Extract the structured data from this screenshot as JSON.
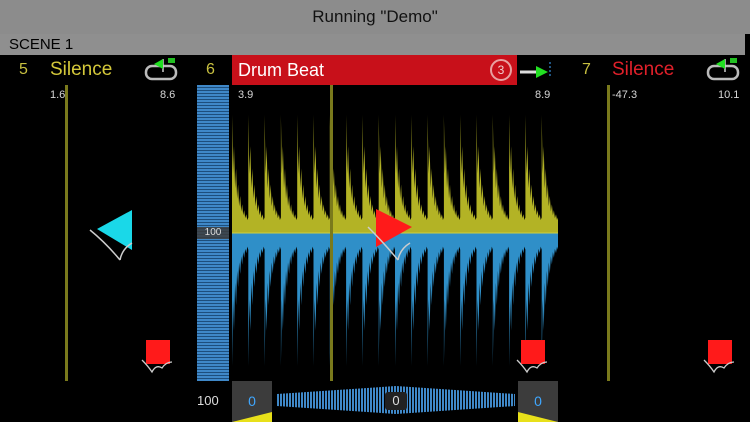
{
  "title": "Running \"Demo\"",
  "scene": "SCENE 1",
  "cells": [
    {
      "number": "5",
      "name": "Silence",
      "left_value": "1.6",
      "right_value": "8.6",
      "name_color": "#d4c83a",
      "number_color": "#c8c040"
    },
    {
      "number": "6",
      "name": "Drum Beat",
      "left_value": "3.9",
      "right_value": "8.9",
      "loop_count": "3",
      "number_color": "#c8c040",
      "header_color": "#c8101a"
    },
    {
      "number": "7",
      "name": "Silence",
      "left_value": "-47.3",
      "right_value": "10.1",
      "name_color": "#e0202a",
      "number_color": "#c8c040"
    }
  ],
  "volume": {
    "meter_label": "100",
    "bottom_value": "100"
  },
  "pan": {
    "left_value": "0",
    "center_value": "0",
    "right_value": "0"
  },
  "colors": {
    "waveform_top": "#b3b325",
    "waveform_bottom": "#2f8fc8",
    "play_triangle": "#ff1a1a",
    "cyan_triangle": "#1ad8e8",
    "stop_square": "#ff1a1a"
  }
}
